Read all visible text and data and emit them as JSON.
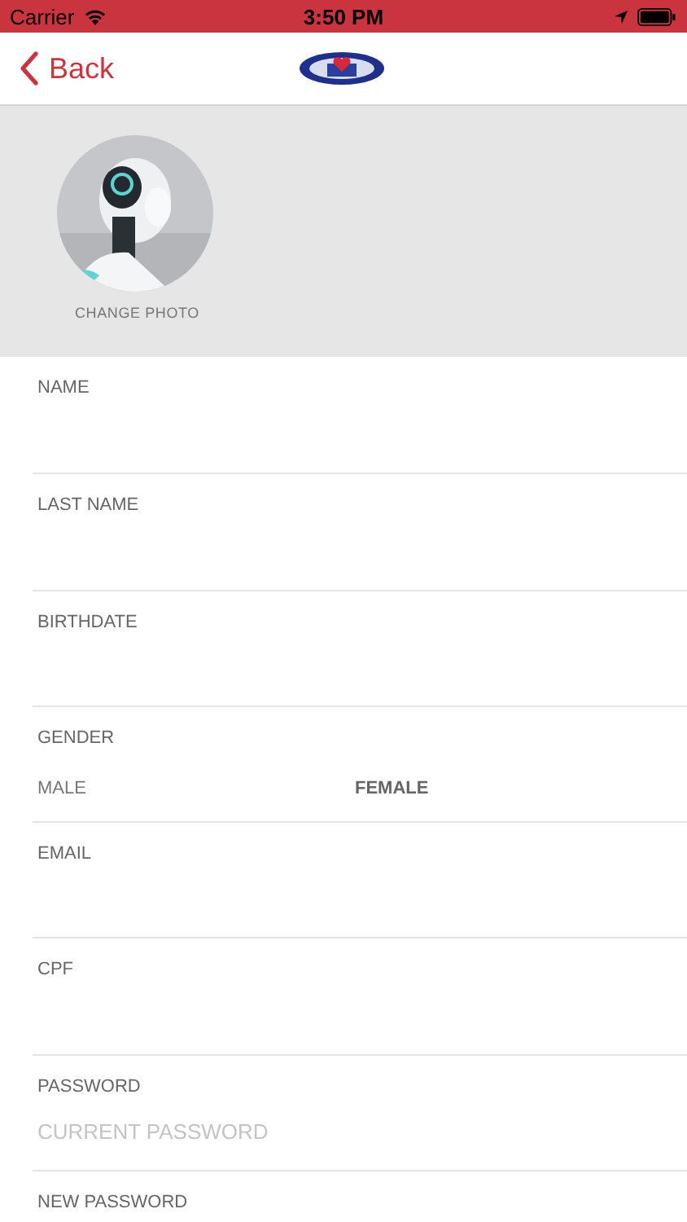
{
  "status_bar": {
    "carrier": "Carrier",
    "time": "3:50 PM"
  },
  "nav": {
    "back_label": "Back"
  },
  "profile": {
    "change_photo_label": "CHANGE PHOTO"
  },
  "fields": [
    {
      "kind": "text",
      "label": "NAME"
    },
    {
      "kind": "text",
      "label": "LAST NAME"
    },
    {
      "kind": "text",
      "label": "BIRTHDATE"
    },
    {
      "kind": "choice",
      "label": "GENDER",
      "options": [
        {
          "label": "MALE",
          "selected": false
        },
        {
          "label": "FEMALE",
          "selected": true
        }
      ]
    },
    {
      "kind": "text",
      "label": "EMAIL"
    },
    {
      "kind": "text",
      "label": "CPF"
    },
    {
      "kind": "text",
      "label": "PASSWORD",
      "placeholder": "CURRENT PASSWORD"
    },
    {
      "kind": "text",
      "label": "NEW PASSWORD"
    }
  ]
}
